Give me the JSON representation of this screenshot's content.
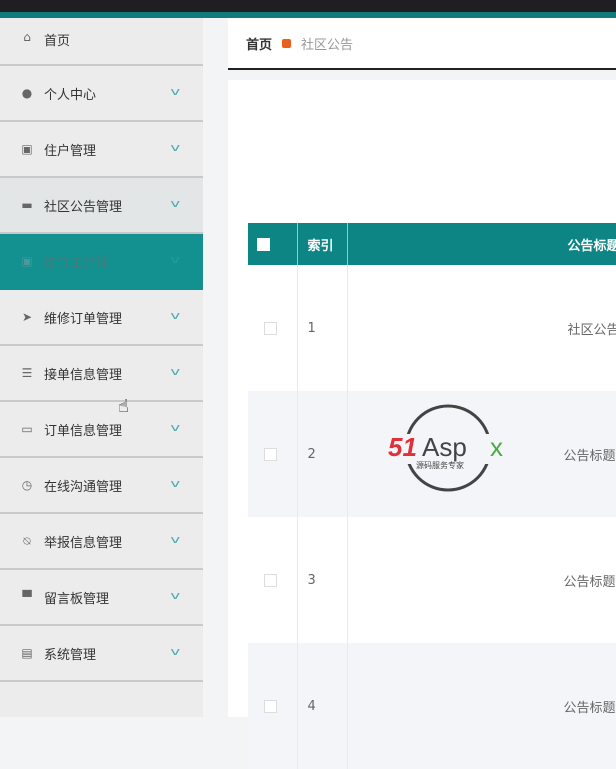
{
  "sidebar": {
    "items": [
      {
        "label": "首页",
        "icon": "home-icon"
      },
      {
        "label": "个人中心",
        "icon": "user-icon"
      },
      {
        "label": "住户管理",
        "icon": "clipboard-icon"
      },
      {
        "label": "社区公告管理",
        "icon": "monitor-icon"
      },
      {
        "label": "维修工管理",
        "icon": "clipboard-icon"
      },
      {
        "label": "维修订单管理",
        "icon": "send-icon"
      },
      {
        "label": "接单信息管理",
        "icon": "sliders-icon"
      },
      {
        "label": "订单信息管理",
        "icon": "message-icon"
      },
      {
        "label": "在线沟通管理",
        "icon": "clock-icon"
      },
      {
        "label": "举报信息管理",
        "icon": "bell-off-icon"
      },
      {
        "label": "留言板管理",
        "icon": "printer-icon"
      },
      {
        "label": "系统管理",
        "icon": "card-icon"
      }
    ]
  },
  "breadcrumb": {
    "home": "首页",
    "current": "社区公告"
  },
  "table": {
    "headers": [
      "索引",
      "公告标题"
    ],
    "rows": [
      {
        "index": "1",
        "title": "社区公告"
      },
      {
        "index": "2",
        "title": "公告标题"
      },
      {
        "index": "3",
        "title": "公告标题"
      },
      {
        "index": "4",
        "title": "公告标题"
      }
    ]
  },
  "watermark": {
    "brand": "51Aspx",
    "tagline": "源码服务专家"
  },
  "colors": {
    "accent": "#0e8585"
  }
}
